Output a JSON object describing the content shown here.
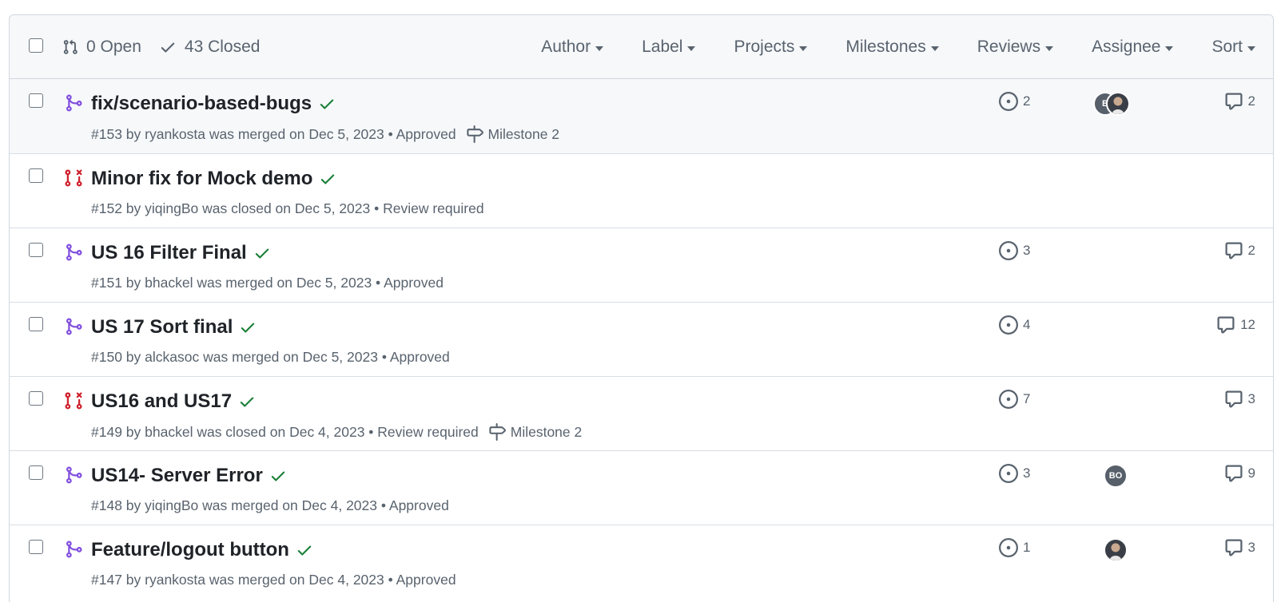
{
  "header": {
    "open_label": "0 Open",
    "closed_label": "43 Closed",
    "filters": [
      "Author",
      "Label",
      "Projects",
      "Milestones",
      "Reviews",
      "Assignee",
      "Sort"
    ]
  },
  "colors": {
    "merged": "#8250df",
    "closed": "#cf222e",
    "check": "#1a7f37",
    "muted": "#59636e"
  },
  "pull_requests": [
    {
      "title": "fix/scenario-based-bugs",
      "state": "merged",
      "meta": "#153 by ryankosta was merged on Dec 5, 2023 • Approved",
      "milestone": "Milestone 2",
      "linked_issues": "2",
      "assignees": [
        "B",
        "photo"
      ],
      "comments": "2"
    },
    {
      "title": "Minor fix for Mock demo",
      "state": "closed",
      "meta": "#152 by yiqingBo was closed on Dec 5, 2023 • Review required",
      "milestone": "",
      "linked_issues": "",
      "assignees": [],
      "comments": ""
    },
    {
      "title": "US 16 Filter Final",
      "state": "merged",
      "meta": "#151 by bhackel was merged on Dec 5, 2023 • Approved",
      "milestone": "",
      "linked_issues": "3",
      "assignees": [],
      "comments": "2"
    },
    {
      "title": "US 17 Sort final",
      "state": "merged",
      "meta": "#150 by alckasoc was merged on Dec 5, 2023 • Approved",
      "milestone": "",
      "linked_issues": "4",
      "assignees": [],
      "comments": "12"
    },
    {
      "title": "US16 and US17",
      "state": "closed",
      "meta": "#149 by bhackel was closed on Dec 4, 2023 • Review required",
      "milestone": "Milestone 2",
      "linked_issues": "7",
      "assignees": [],
      "comments": "3"
    },
    {
      "title": "US14- Server Error",
      "state": "merged",
      "meta": "#148 by yiqingBo was merged on Dec 4, 2023 • Approved",
      "milestone": "",
      "linked_issues": "3",
      "assignees": [
        "BO"
      ],
      "comments": "9"
    },
    {
      "title": "Feature/logout button",
      "state": "merged",
      "meta": "#147 by ryankosta was merged on Dec 4, 2023 • Approved",
      "milestone": "",
      "linked_issues": "1",
      "assignees": [
        "photo"
      ],
      "comments": "3"
    }
  ]
}
